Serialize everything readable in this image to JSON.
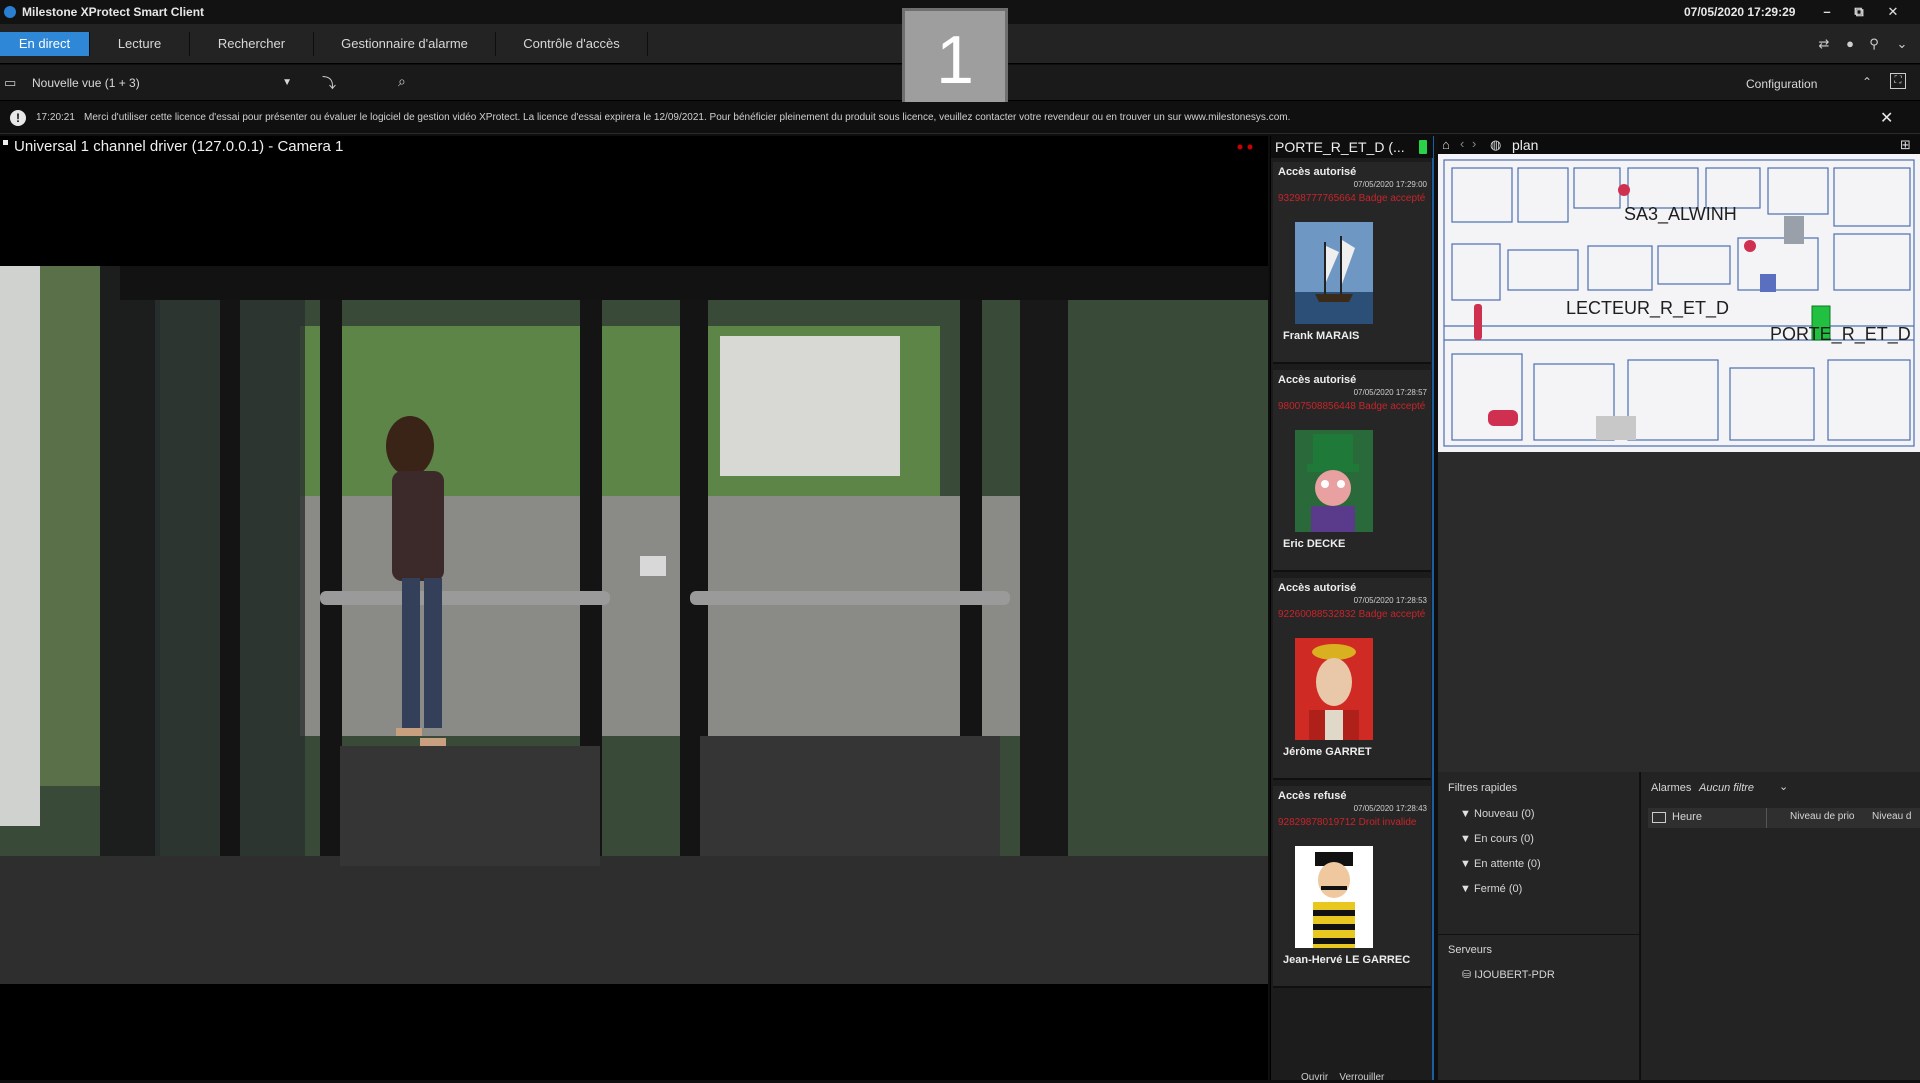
{
  "app": {
    "title": "Milestone XProtect Smart Client",
    "datetime": "07/05/2020 17:29:29",
    "window_buttons": [
      "–",
      "⧉",
      "✕"
    ]
  },
  "tabs": [
    {
      "label": "En direct",
      "active": true
    },
    {
      "label": "Lecture",
      "active": false
    },
    {
      "label": "Rechercher",
      "active": false
    },
    {
      "label": "Gestionnaire d'alarme",
      "active": false
    },
    {
      "label": "Contrôle d'accès",
      "active": false
    }
  ],
  "overlay_number": "1",
  "view": {
    "selected": "Nouvelle vue (1 + 3)",
    "config_label": "Configuration"
  },
  "notice": {
    "time": "17:20:21",
    "text": "Merci d'utiliser cette licence d'essai pour présenter ou évaluer le logiciel de gestion vidéo XProtect. La licence d'essai expirera le 12/09/2021. Pour bénéficier pleinement du produit sous licence, veuillez contacter votre revendeur ou en trouver un sur www.milestonesys.com."
  },
  "camera": {
    "title": "Universal 1 channel driver (127.0.0.1) - Camera 1"
  },
  "access_panel": {
    "title": "PORTE_R_ET_D (...",
    "events": [
      {
        "status": "Accès autorisé",
        "time": "07/05/2020 17:29:00",
        "code": "93298777765664 Badge accepté",
        "name": "Frank MARAIS",
        "photo": "ship-photo"
      },
      {
        "status": "Accès autorisé",
        "time": "07/05/2020 17:28:57",
        "code": "98007508856448 Badge accepté",
        "name": "Eric DECKE",
        "photo": "hatter-photo"
      },
      {
        "status": "Accès autorisé",
        "time": "07/05/2020 17:28:53",
        "code": "92260088532832 Badge accepté",
        "name": "Jérôme GARRET",
        "photo": "emperor-photo"
      },
      {
        "status": "Accès refusé",
        "time": "07/05/2020 17:28:43",
        "code": "92829878019712 Droit invalide",
        "name": "Jean-Hervé LE GARREC",
        "photo": "dalton-photo"
      }
    ],
    "footer": [
      "Ouvrir",
      "Verrouiller"
    ]
  },
  "map": {
    "title": "plan",
    "labels": [
      "SA3_ALWINH",
      "LECTEUR_R_ET_D",
      "PORTE_R_ET_D"
    ]
  },
  "filters": {
    "heading": "Filtres rapides",
    "items": [
      "Nouveau (0)",
      "En cours (0)",
      "En attente (0)",
      "Fermé (0)"
    ],
    "servers_heading": "Serveurs",
    "server": "IJOUBERT-PDR"
  },
  "alarms": {
    "heading": "Alarmes",
    "filter": "Aucun filtre",
    "columns": [
      "Heure",
      "Niveau de prio",
      "Niveau d"
    ]
  },
  "colors": {
    "accent": "#2f87d8",
    "denied": "#c8242a",
    "door_ok": "#2ad24a"
  }
}
